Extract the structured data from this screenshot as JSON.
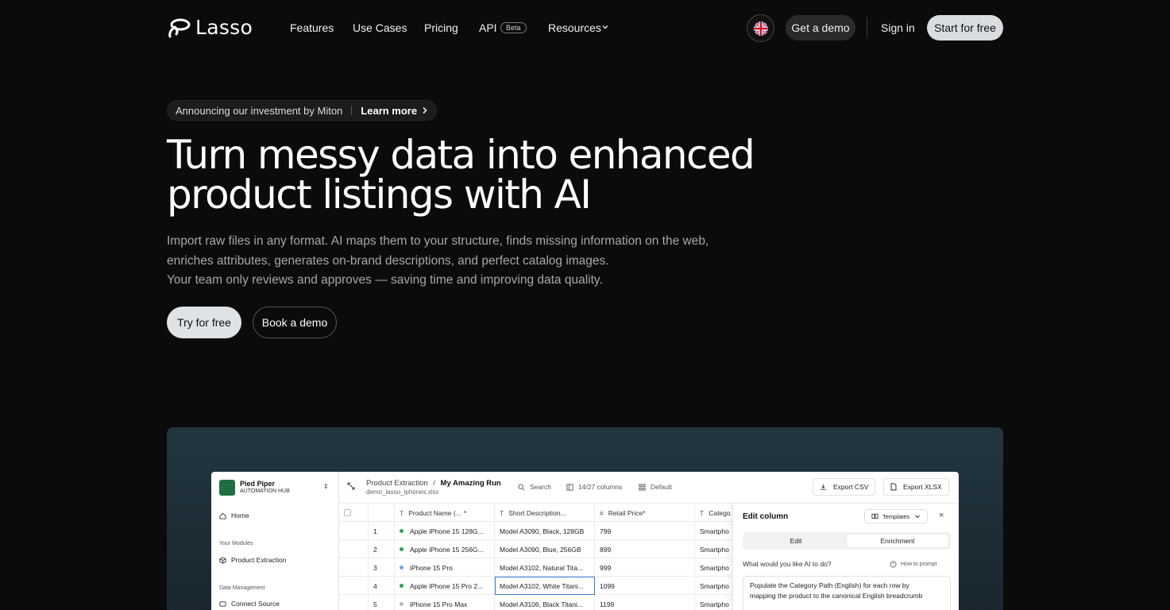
{
  "brand": {
    "name": "Lasso"
  },
  "nav": {
    "links": [
      "Features",
      "Use Cases",
      "Pricing",
      "API",
      "Resources"
    ],
    "api_badge": "Beta",
    "get_demo": "Get a demo",
    "sign_in": "Sign in",
    "start_free": "Start for free"
  },
  "announcement": {
    "text": "Announcing our investment by Miton",
    "link": "Learn more"
  },
  "hero": {
    "headline_line1": "Turn messy data into enhanced",
    "headline_line2": "product listings with AI",
    "sub_line1": "Import raw files in any format. AI maps them to your structure, finds missing information on the web,",
    "sub_line2": "enriches attributes, generates on-brand descriptions, and perfect catalog images.",
    "sub_line3": "Your team only reviews and approves — saving time and improving data quality.",
    "try_free": "Try for free",
    "book_demo": "Book a demo"
  },
  "app": {
    "workspace": {
      "name": "Pied Piper",
      "sub": "AUTOMATION HUB"
    },
    "sidebar": {
      "home": "Home",
      "your_modules": "Your Modules",
      "product_extraction": "Product Extraction",
      "data_management": "Data Management",
      "connect_source": "Connect Source"
    },
    "topbar": {
      "crumb_parent": "Product Extraction",
      "crumb_sep": "/",
      "crumb_current": "My Amazing Run",
      "file": "demo_lasso_iphones.xlsx",
      "search": "Search",
      "columns": "14/27 columns",
      "view": "Default",
      "export_csv": "Export CSV",
      "export_xlsx": "Export XLSX"
    },
    "table": {
      "headers": [
        "Product Name (...",
        "Short Description...",
        "Retail Price",
        "Catego"
      ],
      "rows": [
        {
          "n": "1",
          "name": "Apple iPhone 15 128G...",
          "desc": "Model A3090, Black, 128GB",
          "price": "799",
          "cat": "Smartpho",
          "status": "#22a55a"
        },
        {
          "n": "2",
          "name": "Apple iPhone 15 256G...",
          "desc": "Model A3090, Blue, 256GB",
          "price": "899",
          "cat": "Smartpho",
          "status": "#22a55a"
        },
        {
          "n": "3",
          "name": "iPhone 15 Pro",
          "desc": "Model A3102, Natural Tita...",
          "price": "999",
          "cat": "Smartpho",
          "status": "#6ba7e0"
        },
        {
          "n": "4",
          "name": "Apple iPhone 15 Pro 2...",
          "desc": "Model A3102, White Titani...",
          "price": "1099",
          "cat": "Smartpho",
          "status": "#22a55a"
        },
        {
          "n": "5",
          "name": "iPhone 15 Pro Max",
          "desc": "Model A3106, Black Titani...",
          "price": "1199",
          "cat": "Smartpho",
          "status": "#bbbbbb"
        }
      ]
    },
    "panel": {
      "title": "Edit column",
      "templates": "Templates",
      "tab_edit": "Edit",
      "tab_enrichment": "Enrichment",
      "question": "What would you like AI to do?",
      "how_to": "How to prompt",
      "prompt_line1": "Populate the Category Path (English) for each row by",
      "prompt_line2": "mapping the product to the canonical English breadcrumb"
    }
  }
}
